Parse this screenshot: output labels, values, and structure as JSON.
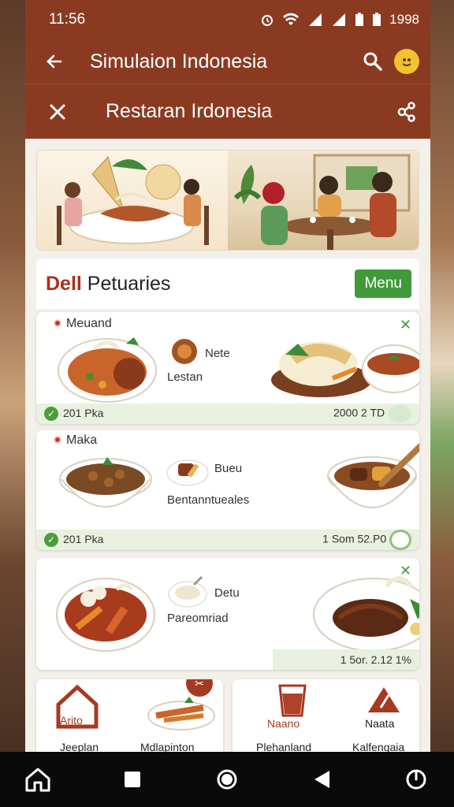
{
  "status_bar": {
    "time": "11:56",
    "right_text": "1998"
  },
  "app_bar": {
    "title": "Simulaion Indonesia"
  },
  "sub_bar": {
    "title": "Restaran Irdonesia"
  },
  "section": {
    "title_red": "Dell",
    "title_rest": " Petuaries",
    "menu_button": "Menu"
  },
  "cards": [
    {
      "label": "Meuand",
      "item_name": "Nete",
      "item_sub": "Lestan",
      "footer_left": "201 Pka",
      "footer_right": "2000 2 TD"
    },
    {
      "label": "Maka",
      "item_name": "Bueu",
      "item_sub": "Bentanntueales",
      "footer_left": "201 Pka",
      "footer_right": "1 Som 52.P0"
    },
    {
      "label": "",
      "item_name": "Detu",
      "item_sub": "Pareomriad",
      "footer_left": "",
      "footer_right": "1 5or. 2.12 1%"
    }
  ],
  "bottom_cards": [
    {
      "badge": "Arito",
      "caption_left": "Jeeplan",
      "caption_right": "Mdlapinton"
    },
    {
      "badge": "Naano",
      "badge2": "Naata",
      "caption_left": "Plehanland",
      "caption_right": "Kalfengaia"
    }
  ],
  "colors": {
    "brand": "#8b3a22",
    "accent_green": "#3f9a3a",
    "red": "#b12c1c"
  },
  "icons": {
    "back": "arrow-left-icon",
    "search": "search-icon",
    "close": "close-icon",
    "share": "share-icon",
    "home": "home-icon",
    "recents": "square-icon",
    "circle": "circle-icon",
    "back_nav": "triangle-back-icon",
    "power": "power-icon"
  }
}
